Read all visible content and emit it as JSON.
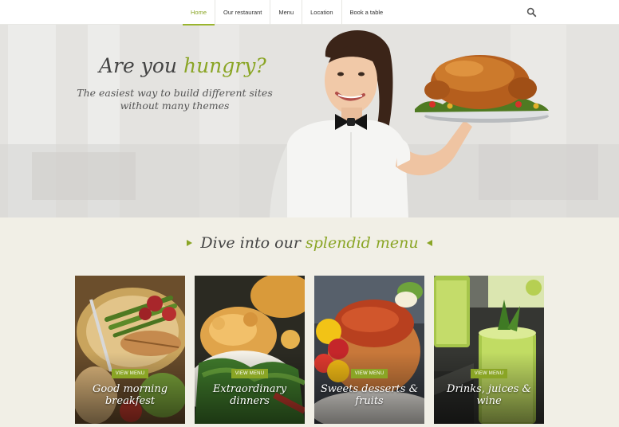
{
  "nav": {
    "items": [
      {
        "label": "Home"
      },
      {
        "label": "Our restaurant"
      },
      {
        "label": "Menu"
      },
      {
        "label": "Location"
      },
      {
        "label": "Book a table"
      }
    ],
    "active_index": 0,
    "search_icon": "search-icon"
  },
  "hero": {
    "title_prefix": "Are you ",
    "title_accent": "hungry?",
    "subtitle_line1": "The easiest way to build different sites",
    "subtitle_line2": "without many themes"
  },
  "menu": {
    "heading_prefix": "Dive into our ",
    "heading_accent": "splendid menu",
    "cards": [
      {
        "button": "VIEW MENU",
        "title_line1": "Good morning",
        "title_line2": "breakfest"
      },
      {
        "button": "VIEW MENU",
        "title_line1": "Extraordinary",
        "title_line2": "dinners"
      },
      {
        "button": "VIEW MENU",
        "title_line1": "Sweets desserts &",
        "title_line2": "fruits"
      },
      {
        "button": "VIEW MENU",
        "title_line1": "Drinks, juices &",
        "title_line2": "wine"
      }
    ]
  },
  "colors": {
    "accent": "#8aa525",
    "page_background": "#f1efe6",
    "nav_background": "#ffffff"
  }
}
